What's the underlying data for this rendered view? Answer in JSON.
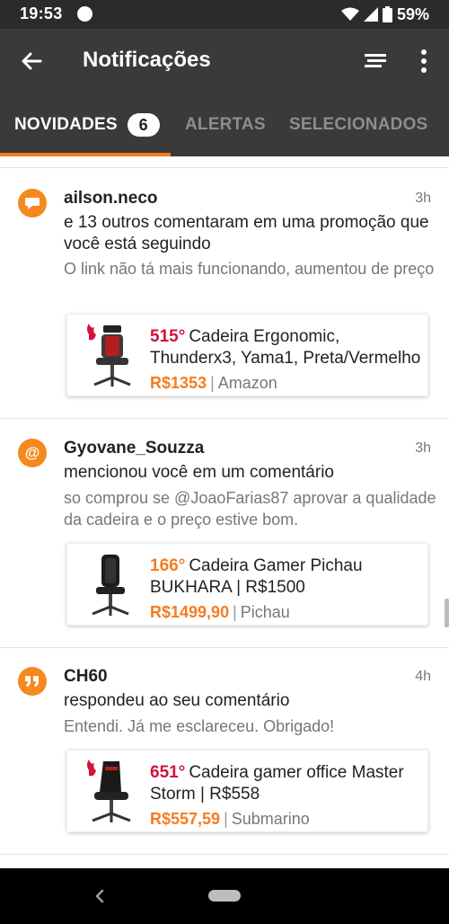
{
  "status_bar": {
    "time": "19:53",
    "battery_percent": "59%",
    "icons": [
      "notification-dot-icon",
      "wifi-icon",
      "signal-icon",
      "battery-icon"
    ]
  },
  "app_bar": {
    "title": "Notificações",
    "icons": [
      "back-arrow-icon",
      "filter-icon",
      "more-vert-icon"
    ]
  },
  "tabs": [
    {
      "label": "NOVIDADES",
      "badge": "6",
      "selected": true
    },
    {
      "label": "ALERTAS",
      "selected": false
    },
    {
      "label": "SELECIONADOS",
      "selected": false
    }
  ],
  "colors": {
    "accent": "#f57c1f",
    "temp_hot": "#d2133c",
    "temp_warm": "#f57c1f",
    "app_bar": "#3a3a3a",
    "status_bar": "#2b2b2b"
  },
  "notifications": [
    {
      "icon": "comment-bubble-icon",
      "user": "ailson.neco",
      "time": "3h",
      "action": "e 13 outros comentaram em uma promoção que você está seguindo",
      "comment": "O link não tá mais funcionando, aumentou de preço",
      "deal": {
        "temperature": "515°",
        "temperature_style": "hot",
        "title": "Cadeira Ergonomic, Thunderx3, Yama1, Preta/Vermelho",
        "price": "R$1353",
        "store": "Amazon",
        "hot_badge": true
      }
    },
    {
      "icon": "at-sign-icon",
      "user": "Gyovane_Souzza",
      "time": "3h",
      "action": "mencionou você em um comentário",
      "comment": "so comprou se @JoaoFarias87 aprovar a qualidade da cadeira e o preço estive bom.",
      "deal": {
        "temperature": "166°",
        "temperature_style": "warm",
        "title": "Cadeira Gamer Pichau BUKHARA | R$1500",
        "price": "R$1499,90",
        "store": "Pichau",
        "hot_badge": false
      }
    },
    {
      "icon": "quote-icon",
      "user": "CH60",
      "time": "4h",
      "action": "respondeu ao seu comentário",
      "comment": "Entendi. Já me esclareceu. Obrigado!",
      "deal": {
        "temperature": "651°",
        "temperature_style": "hot",
        "title": "Cadeira gamer office Master Storm | R$558",
        "price": "R$557,59",
        "store": "Submarino",
        "hot_badge": true
      }
    }
  ],
  "nav_bar": {
    "icons": [
      "nav-back-icon",
      "nav-home-pill-icon"
    ]
  }
}
